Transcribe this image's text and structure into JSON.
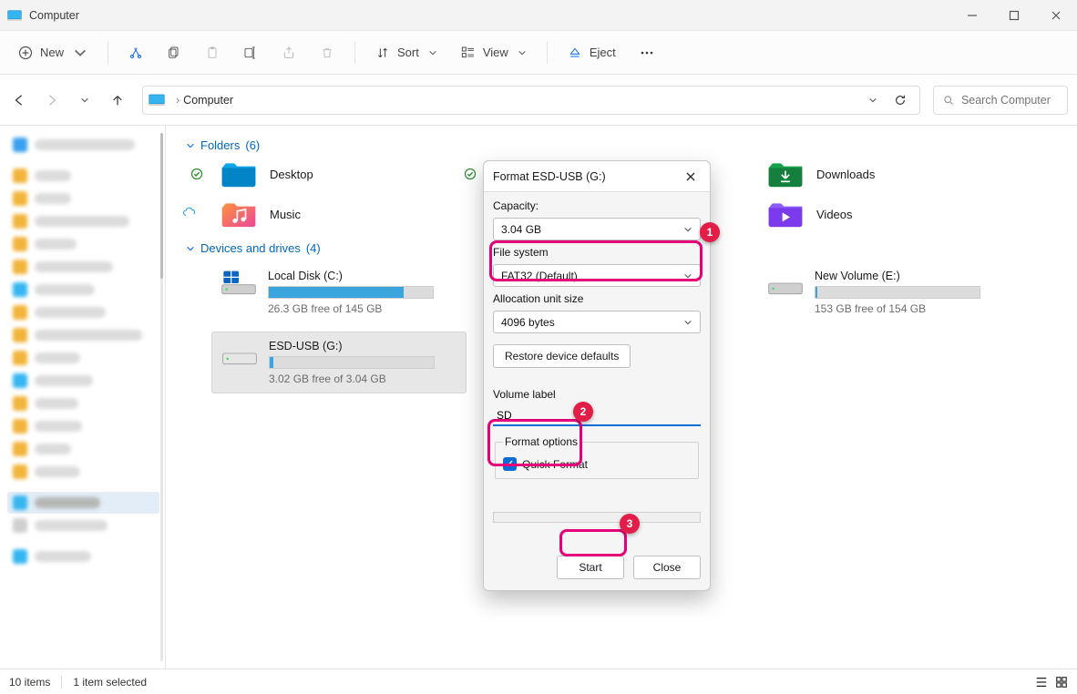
{
  "window": {
    "title": "Computer"
  },
  "toolbar": {
    "new": "New",
    "sort": "Sort",
    "view": "View",
    "eject": "Eject"
  },
  "breadcrumb": {
    "root": "Computer"
  },
  "search": {
    "placeholder": "Search Computer"
  },
  "sections": {
    "folders": {
      "label": "Folders",
      "count": "(6)"
    },
    "devices": {
      "label": "Devices and drives",
      "count": "(4)"
    }
  },
  "folders": [
    {
      "name": "Desktop",
      "icon": "desktop",
      "check": true
    },
    {
      "name": "",
      "icon": "documents",
      "check": true,
      "hidden": true
    },
    {
      "name": "Downloads",
      "icon": "downloads",
      "check": false
    },
    {
      "name": "Music",
      "icon": "music",
      "check": false,
      "cloud": true
    },
    {
      "name": "",
      "icon": "pictures",
      "check": false,
      "hidden": true
    },
    {
      "name": "Videos",
      "icon": "videos",
      "check": false
    }
  ],
  "devices": [
    {
      "name": "Local Disk (C:)",
      "free": "26.3 GB free of 145 GB",
      "pct": 0.82,
      "icon": "os",
      "selected": false
    },
    {
      "name": "",
      "free": "",
      "pct": 0,
      "icon": "hdd",
      "selected": false,
      "hidden": true
    },
    {
      "name": "New Volume (E:)",
      "free": "153 GB free of 154 GB",
      "pct": 0.01,
      "icon": "hdd",
      "selected": false
    },
    {
      "name": "ESD-USB (G:)",
      "free": "3.02 GB free of 3.04 GB",
      "pct": 0.02,
      "icon": "usb",
      "selected": true
    }
  ],
  "dialog": {
    "title": "Format ESD-USB (G:)",
    "labels": {
      "capacity": "Capacity:",
      "filesystem": "File system",
      "alloc": "Allocation unit size",
      "volume": "Volume label",
      "options": "Format options",
      "quick": "Quick Format",
      "restore": "Restore device defaults",
      "start": "Start",
      "close": "Close"
    },
    "values": {
      "capacity": "3.04 GB",
      "filesystem": "FAT32 (Default)",
      "alloc": "4096 bytes",
      "volume": "SD",
      "quick": true
    }
  },
  "status": {
    "items": "10 items",
    "selected": "1 item selected"
  },
  "annotations": {
    "1": "1",
    "2": "2",
    "3": "3"
  }
}
